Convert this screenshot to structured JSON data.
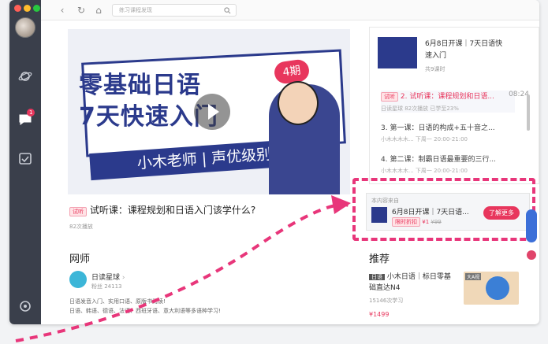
{
  "topbar": {
    "search_placeholder": "练习课程发现"
  },
  "rail": {
    "badge": "1"
  },
  "banner": {
    "line1": "零基础日语",
    "line2": "7天快速入门",
    "sub": "小木老师 | 声优级别",
    "tag": "4期"
  },
  "lesson": {
    "tag": "试听",
    "title": "试听课：课程规划和日语入门该学什么?",
    "plays": "82次播放"
  },
  "teacher": {
    "section": "网师",
    "name": "日读星球",
    "meta": "粉丝 24113",
    "desc1": "日语发音入门、实用口语、原版书阅读!",
    "desc2": "日语、韩语、德语、法语、西班牙语、意大利语等多语种学习!"
  },
  "course": {
    "title_l1": "6月8日开课｜7天日语快",
    "title_l2": "速入门",
    "count": "共9课时",
    "items": [
      {
        "tag": "试听",
        "title": "2. 试听课：课程规划和日语...",
        "time": "08:24",
        "sub": "日读星球    82次播放    已学至23%"
      },
      {
        "title": "3. 第一课：日语的构成+五十音之...",
        "sub": "小木木木木...     下周一 20:00-21:00"
      },
      {
        "title": "4. 第二课：制霸日语最重要的三行...",
        "sub": "小木木木木...     下周一 20:00-21:00"
      }
    ]
  },
  "recommend_box": {
    "label": "本内容来自",
    "title": "6月8日开课｜7天日语...",
    "price_tag": "限时折扣",
    "price": "¥1",
    "old": "¥99",
    "button": "了解更多"
  },
  "recommend": {
    "section": "推荐",
    "tag": "日语",
    "title_l1": "小木日语｜标日零基",
    "title_l2": "础直达N4",
    "count": "15146次学习",
    "price": "¥1499",
    "thumb_label": "大A视"
  },
  "colors": {
    "accent": "#e8365d",
    "brand": "#2b3a8c",
    "annotation": "#e8367a"
  }
}
